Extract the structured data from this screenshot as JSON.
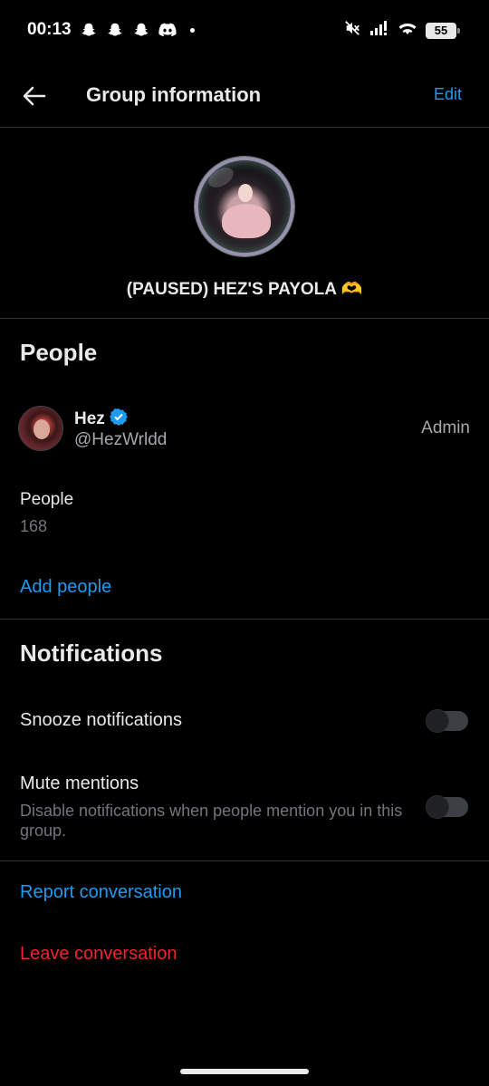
{
  "status_bar": {
    "time": "00:13",
    "left_icons": [
      "snapchat-icon",
      "snapchat-icon",
      "snapchat-icon",
      "discord-icon"
    ],
    "right_icons": [
      "mute-icon",
      "signal-icon",
      "wifi-icon"
    ],
    "battery_level": "55"
  },
  "header": {
    "title": "Group information",
    "edit_label": "Edit"
  },
  "group": {
    "name": "(PAUSED) HEZ'S PAYOLA 🫶"
  },
  "people_section": {
    "title": "People",
    "members": [
      {
        "name": "Hez",
        "handle": "@HezWrldd",
        "role": "Admin",
        "verified": true
      }
    ],
    "count_label": "People",
    "count_value": "168",
    "add_people_label": "Add people"
  },
  "notifications_section": {
    "title": "Notifications",
    "snooze_label": "Snooze notifications",
    "snooze_on": false,
    "mute_label": "Mute mentions",
    "mute_description": "Disable notifications when people mention you in this group.",
    "mute_on": false
  },
  "actions": {
    "report_label": "Report conversation",
    "leave_label": "Leave conversation"
  },
  "colors": {
    "accent": "#1d9bf0",
    "danger": "#f4212e",
    "background": "#000000"
  }
}
